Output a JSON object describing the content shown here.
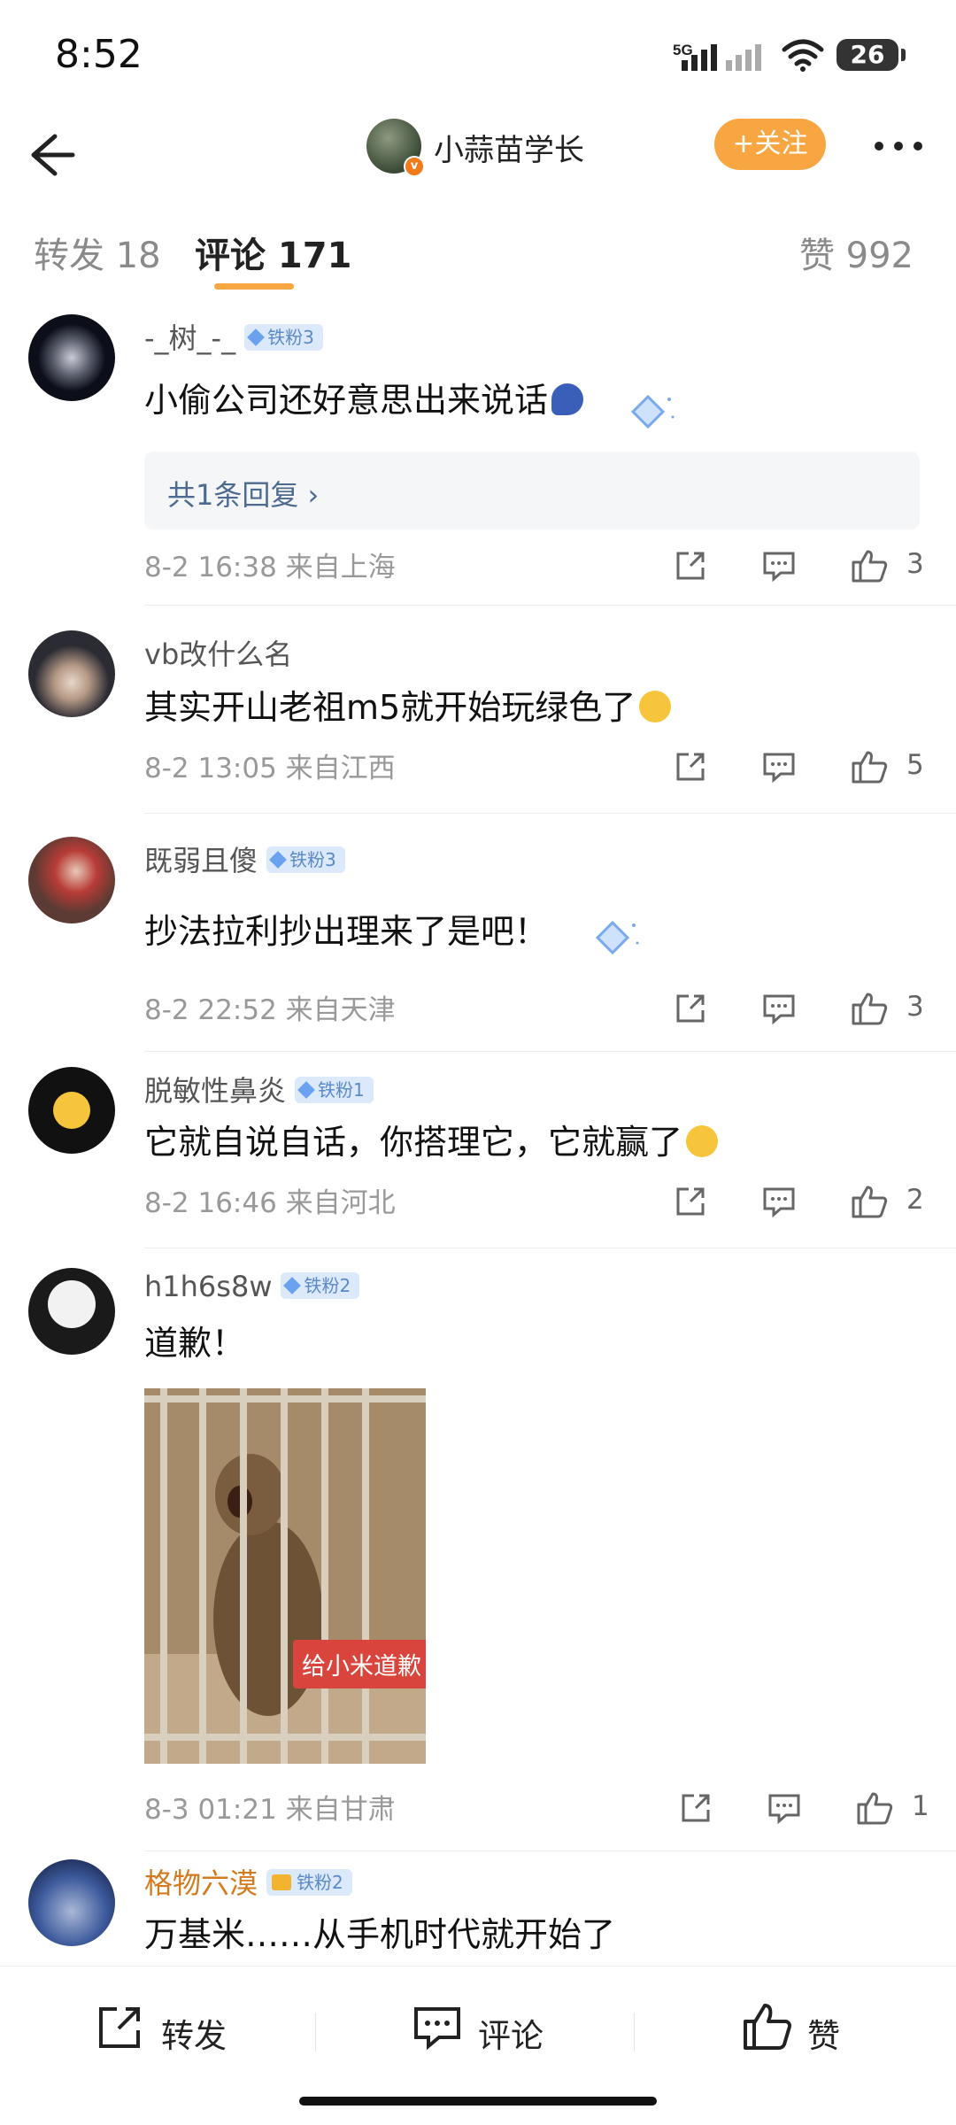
{
  "status_bar": {
    "time": "8:52",
    "network": "5G",
    "battery": "26"
  },
  "header": {
    "author_name": "小蒜苗学长",
    "follow_label": "+关注",
    "verified_mark": "v"
  },
  "tabs": {
    "repost": "转发 18",
    "comment": "评论 171",
    "like": "赞 992"
  },
  "comments": [
    {
      "name": "-_树_-_",
      "badge": "铁粉3",
      "text": "小偷公司还好意思出来说话",
      "reply": "共1条回复 ›",
      "meta": "8-2 16:38 来自上海",
      "likes": "3",
      "avatar_color": "#0c0f1a"
    },
    {
      "name": "vb改什么名",
      "badge": "",
      "text": "其实开山老祖m5就开始玩绿色了",
      "meta": "8-2 13:05 来自江西",
      "likes": "5",
      "avatar_color": "#2b2b33"
    },
    {
      "name": "既弱且傻",
      "badge": "铁粉3",
      "text": "抄法拉利抄出理来了是吧！",
      "meta": "8-2 22:52 来自天津",
      "likes": "3",
      "avatar_color": "#5b3b33"
    },
    {
      "name": "脱敏性鼻炎",
      "badge": "铁粉1",
      "text": "它就自说自话，你搭理它，它就赢了",
      "meta": "8-2 16:46 来自河北",
      "likes": "2",
      "avatar_color": "#111111"
    },
    {
      "name": "h1h6s8w",
      "badge": "铁粉2",
      "text": "道歉！",
      "image_tag": "给小米道歉",
      "meta": "8-3 01:21 来自甘肃",
      "likes": "1",
      "avatar_color": "#1a1a1a"
    },
    {
      "name": "格物六漠",
      "badge": "铁粉2",
      "text": "万基米……从手机时代就开始了",
      "avatar_color": "#3d5a9c"
    }
  ],
  "bottom_bar": {
    "repost": "转发",
    "comment": "评论",
    "like": "赞"
  },
  "colors": {
    "accent": "#f8a642",
    "vip_name": "#d47a1e",
    "badge_bg": "#dbe9fb",
    "badge_text": "#5a89c8"
  }
}
